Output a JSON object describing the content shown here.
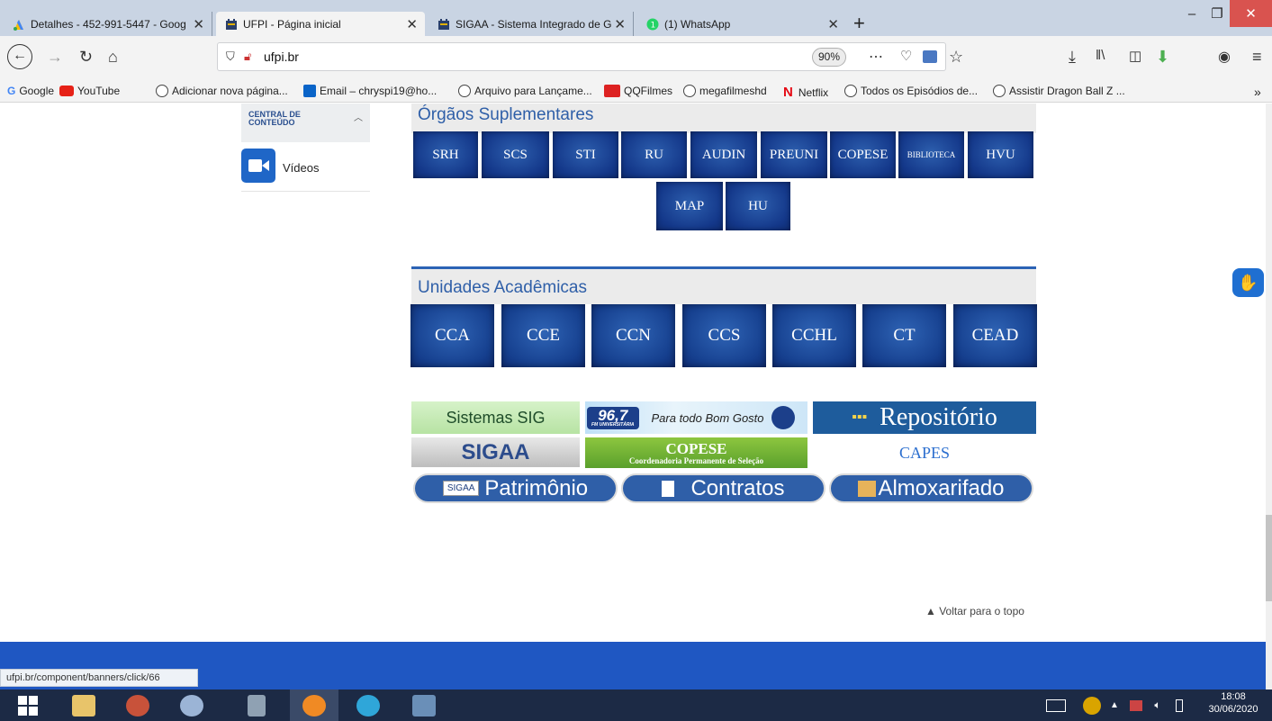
{
  "tabs": [
    {
      "title": "Detalhes - 452-991-5447 - Goog",
      "icon": "google-ads-icon"
    },
    {
      "title": "UFPI - Página inicial",
      "icon": "ufpi-icon"
    },
    {
      "title": "SIGAA - Sistema Integrado de G",
      "icon": "ufpi-icon"
    },
    {
      "title": "(1) WhatsApp",
      "icon": "whatsapp-icon"
    }
  ],
  "address": {
    "url": "ufpi.br",
    "zoom": "90%"
  },
  "bookmarks": [
    "Google",
    "YouTube",
    "Adicionar nova página...",
    "Email – chryspi19@ho...",
    "Arquivo para Lançame...",
    "QQFilmes",
    "megafilmeshd",
    "Netflix",
    "Todos os Episódios de...",
    "Assistir Dragon Ball Z ..."
  ],
  "sidebar": {
    "title": "CENTRAL DE CONTEÚDO",
    "item": "Vídeos"
  },
  "orgaos": {
    "title": "Órgãos Suplementares",
    "row1": [
      "SRH",
      "SCS",
      "STI",
      "RU",
      "AUDIN",
      "PREUNI",
      "COPESE",
      "BIBLIOTECA",
      "HVU"
    ],
    "row2": [
      "MAP",
      "HU"
    ]
  },
  "unidades": {
    "title": "Unidades Acadêmicas",
    "items": [
      "CCA",
      "CCE",
      "CCN",
      "CCS",
      "CCHL",
      "CT",
      "CEAD"
    ]
  },
  "banners": {
    "sistemas": "Sistemas SIG",
    "radio": {
      "freq": "96,7",
      "sub": "FM UNIVERSITÁRIA",
      "slogan": "Para todo Bom Gosto"
    },
    "repositorio": "Repositório",
    "sigaa": "SIGAA",
    "copese": {
      "title": "COPESE",
      "sub": "Coordenadoria Permanente de Seleção"
    },
    "capes": "CAPES",
    "patrimonio": {
      "badge": "SIGAA",
      "label": "Patrimônio"
    },
    "contratos": "Contratos",
    "almoxarifado": "Almoxarifado"
  },
  "back_to_top": "Voltar para o topo",
  "status_url": "ufpi.br/component/banners/click/66",
  "clock": {
    "time": "18:08",
    "date": "30/06/2020"
  },
  "colors": {
    "ufpi_blue": "#1f57c2",
    "button_blue": "#16408f",
    "heading_blue": "#2f5fa8"
  }
}
